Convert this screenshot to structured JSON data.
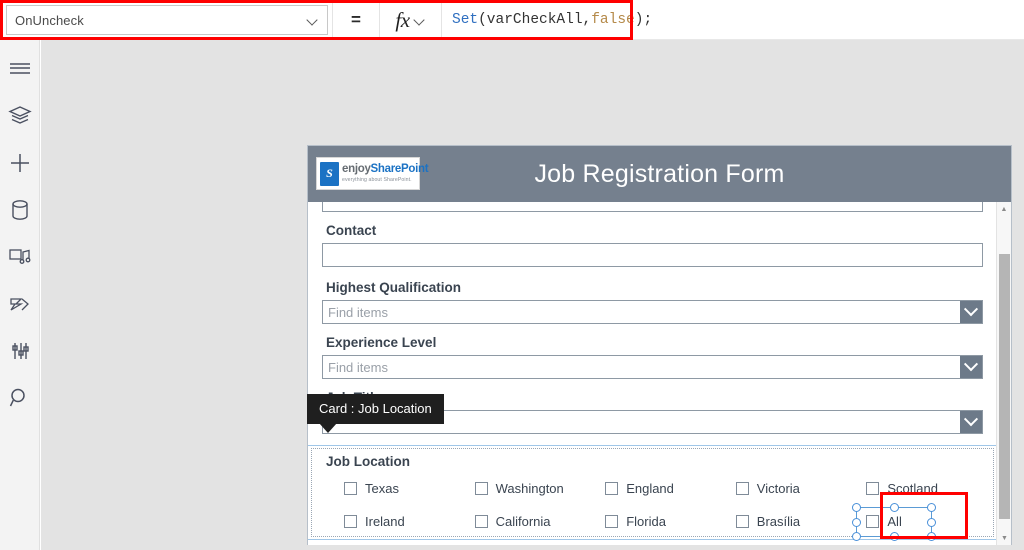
{
  "formula_bar": {
    "property_name": "OnUncheck",
    "equals_label": "=",
    "fx_label": "fx",
    "formula_tokens": {
      "fn": "Set",
      "args": "(varCheckAll,",
      "bool": "false",
      "tail": ");"
    }
  },
  "sidebar": {
    "items": [
      {
        "icon": "hamburger-menu-icon",
        "label": "Menu"
      },
      {
        "icon": "tree-view-icon",
        "label": "Tree view"
      },
      {
        "icon": "insert-plus-icon",
        "label": "Insert"
      },
      {
        "icon": "data-source-icon",
        "label": "Data"
      },
      {
        "icon": "media-icon",
        "label": "Media"
      },
      {
        "icon": "power-automate-icon",
        "label": "Power Automate"
      },
      {
        "icon": "advanced-tools-icon",
        "label": "Advanced"
      },
      {
        "icon": "search-icon",
        "label": "Search"
      }
    ]
  },
  "app": {
    "title": "Job Registration Form",
    "logo": {
      "mark_glyph": "S",
      "word_primary": "enjoy",
      "word_secondary": "SharePoint",
      "tagline": "everything about SharePoint."
    },
    "fields": [
      {
        "type": "text",
        "label": "",
        "value": "",
        "placeholder": "",
        "clipped": true
      },
      {
        "type": "text",
        "label": "Contact",
        "value": "",
        "placeholder": "",
        "clipped": false
      },
      {
        "type": "combo",
        "label": "Highest Qualification",
        "value": "",
        "placeholder": "Find items"
      },
      {
        "type": "combo",
        "label": "Experience Level",
        "value": "",
        "placeholder": "Find items"
      },
      {
        "type": "combo",
        "label": "Job Title",
        "value": "",
        "placeholder": ""
      }
    ],
    "job_location_card": {
      "label": "Job Location",
      "checkboxes": [
        {
          "label": "Texas",
          "checked": false,
          "selected": false
        },
        {
          "label": "Washington",
          "checked": false,
          "selected": false
        },
        {
          "label": "England",
          "checked": false,
          "selected": false
        },
        {
          "label": "Victoria",
          "checked": false,
          "selected": false
        },
        {
          "label": "Scotland",
          "checked": false,
          "selected": false
        },
        {
          "label": "Ireland",
          "checked": false,
          "selected": false
        },
        {
          "label": "California",
          "checked": false,
          "selected": false
        },
        {
          "label": "Florida",
          "checked": false,
          "selected": false
        },
        {
          "label": "Brasília",
          "checked": false,
          "selected": false
        },
        {
          "label": "All",
          "checked": false,
          "selected": true
        }
      ]
    }
  },
  "tooltip": {
    "text": "Card : Job Location"
  },
  "colors": {
    "annotation_red": "#ff0000",
    "header_slate": "#75808e",
    "selection_blue": "#4a90d9",
    "canvas_gray": "#e3e3e3",
    "formula_fn_blue": "#2f6fc0",
    "formula_bool_tan": "#b58a4a"
  }
}
